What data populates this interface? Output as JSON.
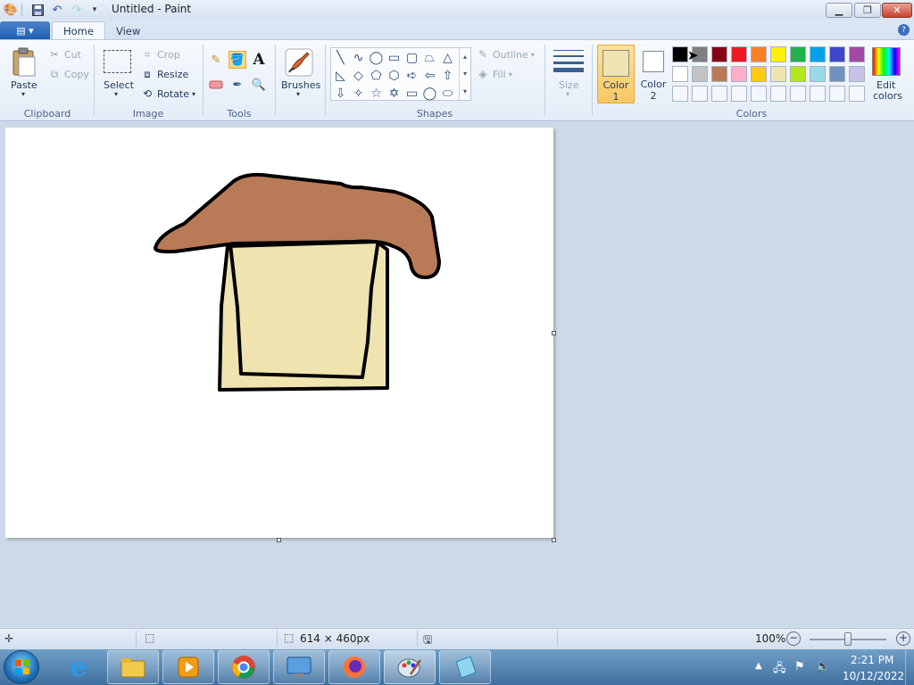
{
  "window": {
    "title": "Untitled - Paint",
    "minimize_icon": "minimize-icon",
    "maximize_icon": "restore-icon",
    "close_icon": "close-icon"
  },
  "quick_access": [
    "app-icon",
    "save-icon",
    "undo-icon",
    "redo-icon",
    "customize-icon"
  ],
  "tabs": [
    {
      "label": "Home",
      "active": true
    },
    {
      "label": "View",
      "active": false
    }
  ],
  "ribbon": {
    "clipboard": {
      "paste": "Paste",
      "cut": "Cut",
      "copy": "Copy",
      "group": "Clipboard"
    },
    "image": {
      "select": "Select",
      "crop": "Crop",
      "resize": "Resize",
      "rotate": "Rotate",
      "group": "Image"
    },
    "tools": {
      "group": "Tools",
      "items": [
        "pencil-icon",
        "fill-icon",
        "text-icon",
        "eraser-icon",
        "color-picker-icon",
        "magnifier-icon"
      ]
    },
    "brushes": {
      "label": "Brushes"
    },
    "shapes": {
      "group": "Shapes",
      "outline": "Outline",
      "fill": "Fill",
      "glyphs": [
        "╲",
        "∿",
        "◯",
        "▭",
        "▢",
        "⏢",
        "△",
        "◺",
        "◇",
        "⬠",
        "⬡",
        "➪",
        "⇦",
        "⇧",
        "⇩",
        "✧",
        "☆",
        "✡",
        "▭",
        "◯",
        "⬭"
      ]
    },
    "size": {
      "label": "Size"
    },
    "colors": {
      "group": "Colors",
      "color1": {
        "label1": "Color",
        "label2": "1",
        "value": "#efe4b0"
      },
      "color2": {
        "label1": "Color",
        "label2": "2",
        "value": "#ffffff"
      },
      "edit": {
        "label1": "Edit",
        "label2": "colors"
      },
      "palette": [
        [
          "#000000",
          "#7f7f7f",
          "#880015",
          "#ed1c24",
          "#ff7f27",
          "#fff200",
          "#22b14c",
          "#00a2e8",
          "#3f48cc",
          "#a349a4"
        ],
        [
          "#ffffff",
          "#c3c3c3",
          "#b97a57",
          "#ffaec9",
          "#ffc90e",
          "#efe4b0",
          "#b5e61d",
          "#99d9ea",
          "#7092be",
          "#c8bfe7"
        ],
        [
          "#f4f7fb",
          "#f4f7fb",
          "#f4f7fb",
          "#f4f7fb",
          "#f4f7fb",
          "#f4f7fb",
          "#f4f7fb",
          "#f4f7fb",
          "#f4f7fb",
          "#f4f7fb"
        ]
      ]
    }
  },
  "drawing": {
    "roof_color": "#b97a57",
    "wall_color": "#efe4b0",
    "outline_color": "#000000"
  },
  "status": {
    "dimensions": "614 × 460px",
    "zoom": "100%",
    "zoom_level": 1.0
  },
  "taskbar": {
    "time": "2:21 PM",
    "date": "10/12/2022",
    "apps": [
      "internet-explorer-icon",
      "file-explorer-icon",
      "media-player-icon",
      "chrome-icon",
      "remote-desktop-icon",
      "firefox-icon",
      "paint-icon",
      "notepad-icon"
    ]
  }
}
